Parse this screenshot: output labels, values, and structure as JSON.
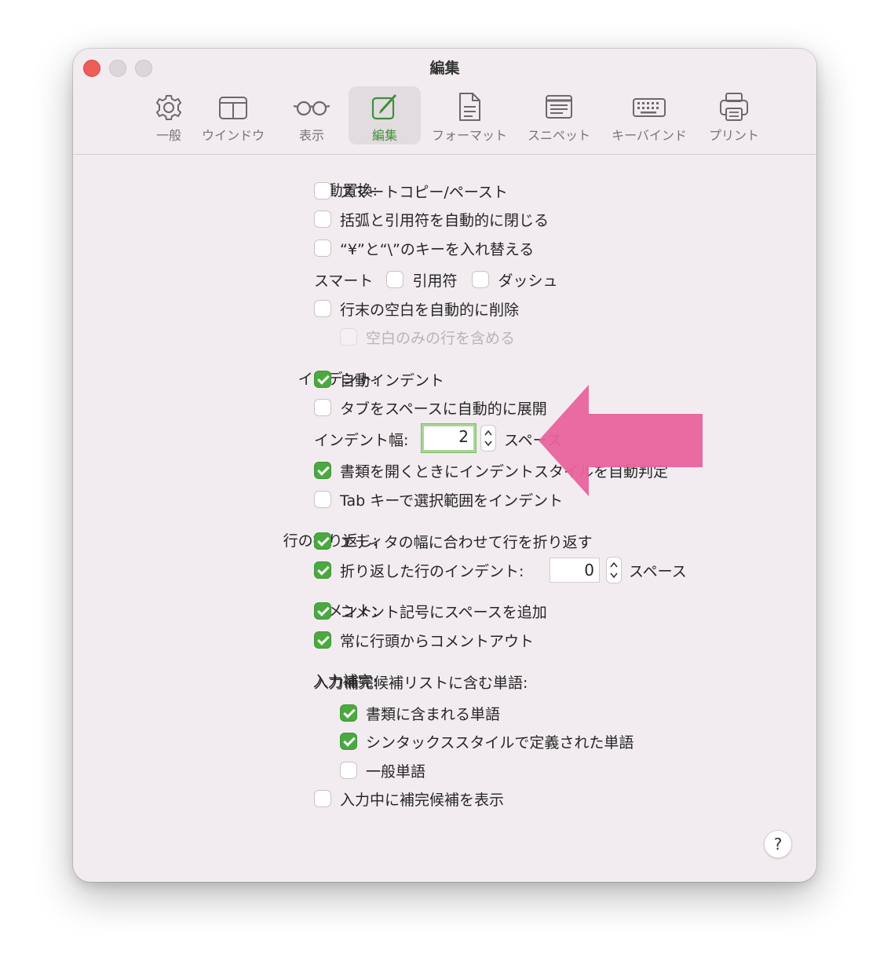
{
  "window": {
    "title": "編集"
  },
  "toolbar": {
    "items": [
      {
        "label": "一般",
        "icon": "gear-icon"
      },
      {
        "label": "ウインドウ",
        "icon": "window-icon"
      },
      {
        "label": "表示",
        "icon": "glasses-icon"
      },
      {
        "label": "編集",
        "icon": "edit-icon",
        "selected": true
      },
      {
        "label": "フォーマット",
        "icon": "document-icon"
      },
      {
        "label": "スニペット",
        "icon": "snippet-icon"
      },
      {
        "label": "キーバインド",
        "icon": "keyboard-icon"
      },
      {
        "label": "プリント",
        "icon": "printer-icon"
      }
    ]
  },
  "auto_replace": {
    "label": "自動置換:",
    "smart_copy_paste": {
      "label": "スマートコピー/ペースト",
      "checked": false
    },
    "auto_close_brackets": {
      "label": "括弧と引用符を自動的に閉じる",
      "checked": false
    },
    "swap_yen_backslash": {
      "label": "“¥”と“\\”のキーを入れ替える",
      "checked": false
    },
    "smart": {
      "label": "スマート",
      "quotes_label": "引用符",
      "quotes_checked": false,
      "dash_label": "ダッシュ",
      "dash_checked": false
    },
    "trim_trailing": {
      "label": "行末の空白を自動的に削除",
      "checked": false
    },
    "include_whitespace_lines": {
      "label": "空白のみの行を含める",
      "checked": false,
      "enabled": false
    }
  },
  "indent": {
    "label": "インデント:",
    "auto_indent": {
      "label": "自動インデント",
      "checked": true
    },
    "expand_tabs": {
      "label": "タブをスペースに自動的に展開",
      "checked": false
    },
    "width": {
      "label": "インデント幅:",
      "value": "2",
      "unit": "スペース"
    },
    "detect_style": {
      "label": "書類を開くときにインデントスタイルを自動判定",
      "checked": true
    },
    "tab_indent_selection": {
      "label": "Tab キーで選択範囲をインデント",
      "checked": false
    }
  },
  "wrap": {
    "label": "行の折り返し:",
    "wrap_to_editor": {
      "label": "エディタの幅に合わせて行を折り返す",
      "checked": true
    },
    "wrapped_indent": {
      "label": "折り返した行のインデント:",
      "checked": true,
      "value": "0",
      "unit": "スペース"
    }
  },
  "comment": {
    "label": "コメント:",
    "add_space": {
      "label": "コメント記号にスペースを追加",
      "checked": true
    },
    "line_head": {
      "label": "常に行頭からコメントアウト",
      "checked": true
    }
  },
  "completion": {
    "label": "入力補完:",
    "list_label": "入力補完候補リストに含む単語:",
    "document_words": {
      "label": "書類に含まれる単語",
      "checked": true
    },
    "syntax_words": {
      "label": "シンタックススタイルで定義された単語",
      "checked": true
    },
    "general_words": {
      "label": "一般単語",
      "checked": false
    },
    "show_while_typing": {
      "label": "入力中に補完候補を表示",
      "checked": false
    }
  },
  "help": {
    "label": "?"
  },
  "colors": {
    "accent_green": "#4aa93f",
    "annotation_arrow": "#e8649c"
  }
}
